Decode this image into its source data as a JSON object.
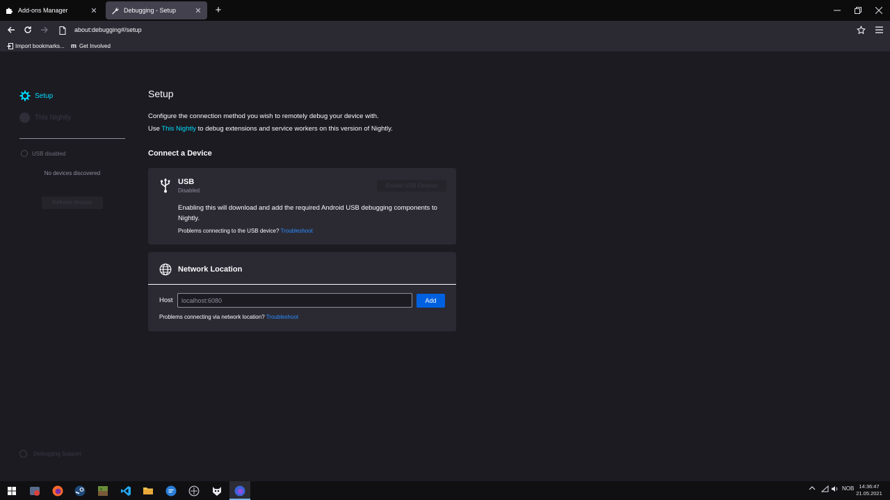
{
  "tabs": [
    {
      "label": "Add-ons Manager",
      "icon": "puzzle-icon",
      "active": false
    },
    {
      "label": "Debugging - Setup",
      "icon": "wrench-icon",
      "active": true
    }
  ],
  "navbar": {
    "url": "about:debugging#/setup"
  },
  "bookmarks": [
    {
      "label": "Import bookmarks...",
      "icon": "import-icon"
    },
    {
      "label": "Get Involved",
      "icon": "m"
    }
  ],
  "sidebar": {
    "setup_label": "Setup",
    "nightly_label": "This Nightly",
    "usb_status": "USB disabled",
    "no_devices": "No devices discovered",
    "refresh_label": "Refresh devices",
    "support_label": "Debugging Support"
  },
  "main": {
    "title": "Setup",
    "intro": "Configure the connection method you wish to remotely debug your device with.",
    "intro2_prefix": "Use ",
    "intro2_link": "This Nightly",
    "intro2_suffix": " to debug extensions and service workers on this version of Nightly.",
    "connect_title": "Connect a Device"
  },
  "usb_card": {
    "title": "USB",
    "subtitle": "Disabled",
    "enable_label": "Enable USB Devices",
    "description": "Enabling this will download and add the required Android USB debugging components to Nightly.",
    "trouble_text": "Problems connecting to the USB device?",
    "trouble_link": "Troubleshoot"
  },
  "network_card": {
    "title": "Network Location",
    "host_label": "Host",
    "host_placeholder": "localhost:6080",
    "add_label": "Add",
    "trouble_text": "Problems connecting via network location?",
    "trouble_link": "Troubleshoot"
  },
  "tray": {
    "language": "NOB",
    "time": "14:36:47",
    "date": "21.05.2021"
  },
  "colors": {
    "accent": "#00ddff",
    "link": "#2b8cff",
    "primary_button": "#0061e0",
    "background": "#1c1b22",
    "card": "#2b2a33"
  }
}
